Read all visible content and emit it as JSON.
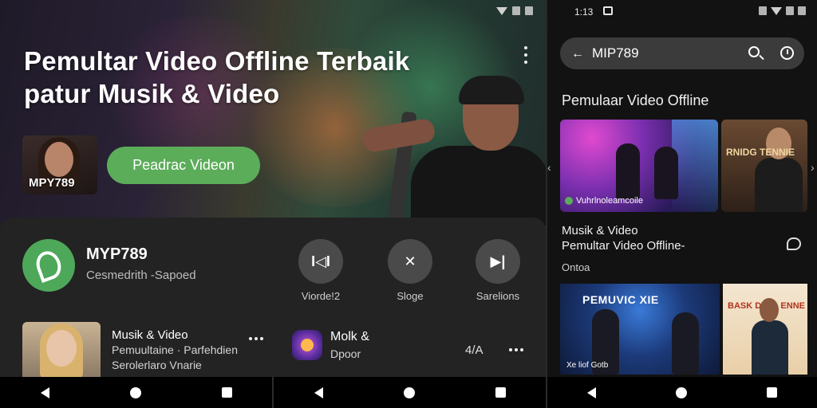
{
  "left": {
    "hero_title_line1": "Pemultar Video Offline Terbaik",
    "hero_title_line2": "patur Musik & Video",
    "thumb_label": "MPY789",
    "cta_label": "Peadrac Videon",
    "app": {
      "name": "MYP789",
      "subtitle": "Cesmedrith -Sapoed"
    },
    "actions": [
      {
        "label": "Viorde!2",
        "icon": "pause-icon",
        "glyph": "I◁I"
      },
      {
        "label": "Sloge",
        "icon": "close-icon",
        "glyph": "✕"
      },
      {
        "label": "Sarelions",
        "icon": "skip-icon",
        "glyph": "▶|"
      }
    ],
    "list_item": {
      "title": "Musik & Video",
      "subtitle1": "Pemuultaine · Parfehdien",
      "subtitle2": "Serolerlaro Vnarie"
    },
    "list_item2": {
      "title": "Molk &",
      "subtitle": "Dpoor",
      "count": "4/A"
    }
  },
  "right": {
    "time": "1:13",
    "search_value": "MIP789",
    "section_title": "Pemulaar Video Offline",
    "card1_caption": "Vuhrlnoleamcoile",
    "card2_text": "RNIDG TENNIE",
    "text1": "Musik & Video",
    "text2": "Pemultar Video Offline-",
    "text3": "Ontoa",
    "card3_banner": "PEMUVIC XIE",
    "card3_caption": "Xe liof Gotb",
    "card4_text": "BASK DALL ENNE"
  },
  "colors": {
    "accent_green": "#5cad5a",
    "sheet_bg": "#232323",
    "right_bg": "#121212",
    "search_bg": "#3b3b3b"
  }
}
